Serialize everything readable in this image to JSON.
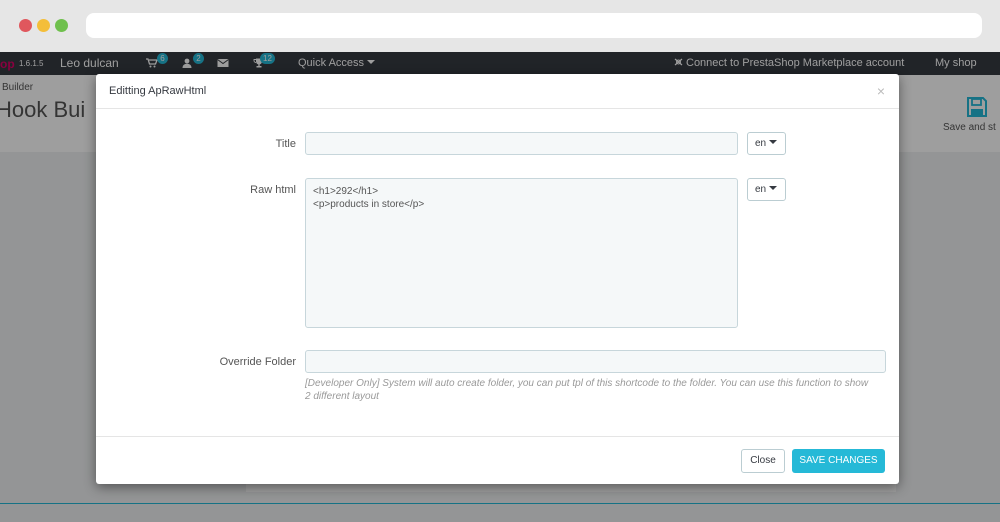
{
  "topbar": {
    "logo_fragment": "op",
    "version": "1.6.1.5",
    "employee": "Leo dulcan",
    "orders_badge": "6",
    "customers_badge": "2",
    "messages_badge": "12",
    "quick_access": "Quick Access",
    "connect": "Connect to PrestaShop Marketplace account",
    "my_shop": "My shop"
  },
  "page": {
    "breadcrumb": "Builder",
    "title": "Hook Bui",
    "save_label": "Save and st"
  },
  "modal": {
    "title": "Editting ApRawHtml",
    "close_symbol": "×",
    "fields": {
      "title_label": "Title",
      "title_value": "",
      "title_lang": "en",
      "raw_label": "Raw html",
      "raw_value": "<h1>292</h1>\n<p>products in store</p>",
      "raw_lang": "en",
      "override_label": "Override Folder",
      "override_value": "",
      "override_help": "[Developer Only] System will auto create folder, you can put tpl of this shortcode to the folder. You can use this function to show 2 different layout"
    },
    "footer": {
      "close_label": "Close",
      "save_label": "SAVE CHANGES"
    }
  },
  "colors": {
    "accent": "#25b9d7",
    "topbar": "#363a41",
    "brand": "#df0067"
  }
}
